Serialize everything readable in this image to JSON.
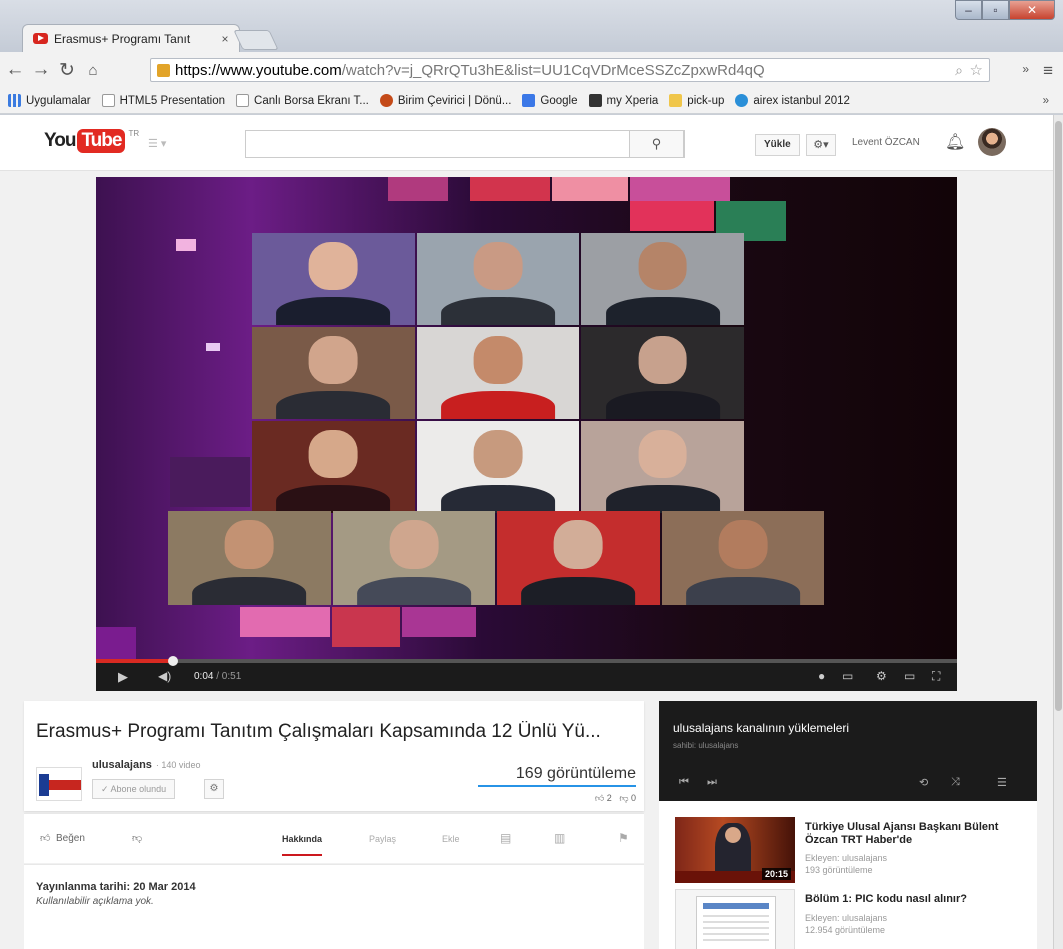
{
  "browser": {
    "tab_title": "Erasmus+ Programı Tanıt",
    "tab_close": "×",
    "url_host": "https://www.youtube.com",
    "url_path": "/watch?v=j_QRrQTu3hE&list=UU1CqVDrMceSSZcZpxwRd4qQ",
    "bookmarks": [
      "Uygulamalar",
      "HTML5 Presentation",
      "Canlı Borsa Ekranı T...",
      "Birim Çevirici | Dönü...",
      "Google",
      "my Xperia",
      "pick-up",
      "airex istanbul 2012"
    ],
    "bookmarks_more": "»"
  },
  "masthead": {
    "logo_you": "You",
    "logo_tube": "Tube",
    "logo_region": "TR",
    "upload_label": "Yükle",
    "user_name": "Levent ÖZCAN"
  },
  "player": {
    "current_time": "0:04",
    "duration": "/ 0:51",
    "progress": 0.09
  },
  "video": {
    "title": "Erasmus+ Programı Tanıtım Çalışmaları Kapsamında 12 Ünlü Yü...",
    "channel_name": "ulusalajans",
    "channel_video_count": "· 140 video",
    "subscribe_label": "✓ Abone olundu",
    "views": "169 görüntüleme",
    "likes": "2",
    "dislikes": "0",
    "like_label": "Beğen",
    "tabs": {
      "about": "Hakkında",
      "share": "Paylaş",
      "embed": "Ekle"
    },
    "published": "Yayınlanma tarihi: 20 Mar 2014",
    "description": "Kullanılabilir açıklama yok."
  },
  "playlist": {
    "title": "ulusalajans kanalının yüklemeleri",
    "owner": "sahibi: ulusalajans"
  },
  "related": [
    {
      "title": "Türkiye Ulusal Ajansı Başkanı Bülent Özcan TRT Haber'de",
      "by": "Ekleyen: ulusalajans",
      "views": "193 görüntüleme",
      "duration": "20:15"
    },
    {
      "title": "Bölüm 1: PIC kodu nasıl alınır?",
      "by": "Ekleyen: ulusalajans",
      "views": "12.954 görüntüleme"
    }
  ],
  "colors": {
    "youtube_red": "#e22a22",
    "progress_red": "#d92a22",
    "video_purple": "#6c1d86",
    "sentiment_blue": "#2793e6"
  }
}
